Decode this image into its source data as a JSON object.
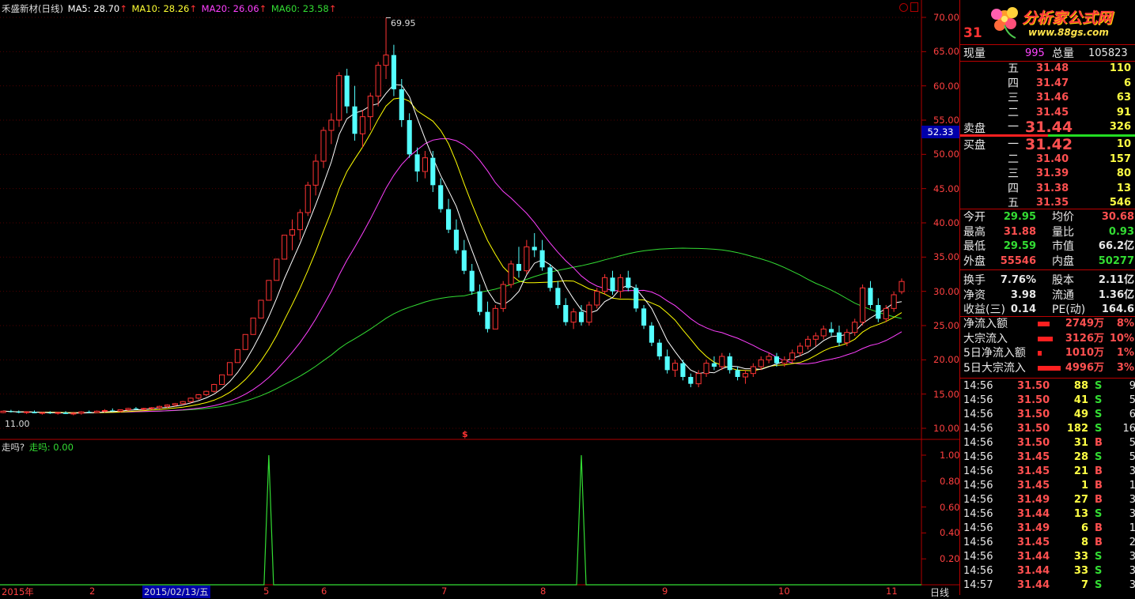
{
  "header": {
    "stock_label": "禾盛新材(日线)",
    "ma5_label": "MA5: 28.70",
    "ma10_label": "MA10: 28.26",
    "ma20_label": "MA20: 26.06",
    "ma60_label": "MA60: 23.58",
    "arrow": "↑"
  },
  "colors": {
    "up": "#ff3333",
    "down": "#54ffff",
    "ma5": "#ffffff",
    "ma10": "#ffff00",
    "ma20": "#ff40ff",
    "ma60": "#33dd33",
    "frame": "#b00000"
  },
  "price_axis": {
    "ticks": [
      "70.00",
      "65.00",
      "60.00",
      "55.00",
      "50.00",
      "45.00",
      "40.00",
      "35.00",
      "30.00",
      "25.00",
      "20.00",
      "15.00",
      "10.00"
    ],
    "current_marker": "52.33",
    "high_label": "69.95",
    "low_label": "11.00"
  },
  "indicator": {
    "title": "走吗?",
    "value_label": "走吗: 0.00",
    "ticks": [
      "1.00",
      "0.80",
      "0.60",
      "0.40",
      "0.20"
    ]
  },
  "time_axis": {
    "labels": [
      "2015年",
      "2",
      "2015/02/13/五",
      "5",
      "6",
      "7",
      "8",
      "9",
      "10",
      "11"
    ],
    "period_label": "日线"
  },
  "marker_s": "$",
  "quote": {
    "code": "31",
    "logo_text": "分析家公式网",
    "logo_url": "www.88gs.com",
    "current_label": "现量",
    "current_value": "995",
    "total_label": "总量",
    "total_value": "105823",
    "sell_label": "卖盘",
    "buy_label": "买盘",
    "asks": [
      {
        "level": "五",
        "price": "31.48",
        "vol": "110"
      },
      {
        "level": "四",
        "price": "31.47",
        "vol": "6"
      },
      {
        "level": "三",
        "price": "31.46",
        "vol": "63"
      },
      {
        "level": "二",
        "price": "31.45",
        "vol": "91"
      },
      {
        "level": "一",
        "price": "31.44",
        "vol": "326"
      }
    ],
    "bids": [
      {
        "level": "一",
        "price": "31.42",
        "vol": "10"
      },
      {
        "level": "二",
        "price": "31.40",
        "vol": "157"
      },
      {
        "level": "三",
        "price": "31.39",
        "vol": "80"
      },
      {
        "level": "四",
        "price": "31.38",
        "vol": "13"
      },
      {
        "level": "五",
        "price": "31.35",
        "vol": "546"
      }
    ],
    "stats": [
      {
        "l1": "今开",
        "v1": "29.95",
        "c1": "grn",
        "l2": "均价",
        "v2": "30.68",
        "c2": "red"
      },
      {
        "l1": "最高",
        "v1": "31.88",
        "c1": "red",
        "l2": "量比",
        "v2": "0.93",
        "c2": "grn"
      },
      {
        "l1": "最低",
        "v1": "29.59",
        "c1": "grn",
        "l2": "市值",
        "v2": "66.2亿",
        "c2": "wht"
      },
      {
        "l1": "外盘",
        "v1": "55546",
        "c1": "red",
        "l2": "内盘",
        "v2": "50277",
        "c2": "grn"
      },
      {
        "l1": "换手",
        "v1": "7.76%",
        "c1": "wht",
        "l2": "股本",
        "v2": "2.11亿",
        "c2": "wht"
      },
      {
        "l1": "净资",
        "v1": "3.98",
        "c1": "wht",
        "l2": "流通",
        "v2": "1.36亿",
        "c2": "wht"
      },
      {
        "l1": "收益(三)",
        "v1": "0.14",
        "c1": "wht",
        "l2": "PE(动)",
        "v2": "164.6",
        "c2": "wht"
      }
    ],
    "flows": [
      {
        "label": "净流入额",
        "value": "2749万",
        "pct": "8%",
        "bar": 0.35
      },
      {
        "label": "大宗流入",
        "value": "3126万",
        "pct": "10%",
        "bar": 0.45
      },
      {
        "label": "5日净流入额",
        "value": "1010万",
        "pct": "1%",
        "bar": 0.12
      },
      {
        "label": "5日大宗流入",
        "value": "4996万",
        "pct": "3%",
        "bar": 0.7
      }
    ],
    "ticks": [
      {
        "time": "14:56",
        "price": "31.50",
        "vol": "88",
        "side": "S",
        "extra": "9"
      },
      {
        "time": "14:56",
        "price": "31.50",
        "vol": "41",
        "side": "S",
        "extra": "5"
      },
      {
        "time": "14:56",
        "price": "31.50",
        "vol": "49",
        "side": "S",
        "extra": "6"
      },
      {
        "time": "14:56",
        "price": "31.50",
        "vol": "182",
        "side": "S",
        "extra": "16"
      },
      {
        "time": "14:56",
        "price": "31.50",
        "vol": "31",
        "side": "B",
        "extra": "5"
      },
      {
        "time": "14:56",
        "price": "31.45",
        "vol": "28",
        "side": "S",
        "extra": "5"
      },
      {
        "time": "14:56",
        "price": "31.45",
        "vol": "21",
        "side": "B",
        "extra": "3"
      },
      {
        "time": "14:56",
        "price": "31.45",
        "vol": "1",
        "side": "B",
        "extra": "1"
      },
      {
        "time": "14:56",
        "price": "31.49",
        "vol": "27",
        "side": "B",
        "extra": "3"
      },
      {
        "time": "14:56",
        "price": "31.44",
        "vol": "13",
        "side": "S",
        "extra": "3"
      },
      {
        "time": "14:56",
        "price": "31.49",
        "vol": "6",
        "side": "B",
        "extra": "1"
      },
      {
        "time": "14:56",
        "price": "31.45",
        "vol": "8",
        "side": "B",
        "extra": "2"
      },
      {
        "time": "14:56",
        "price": "31.44",
        "vol": "33",
        "side": "S",
        "extra": "3"
      },
      {
        "time": "14:56",
        "price": "31.44",
        "vol": "33",
        "side": "S",
        "extra": "3"
      },
      {
        "time": "14:57",
        "price": "31.44",
        "vol": "7",
        "side": "S",
        "extra": "3"
      }
    ]
  },
  "chart_data": {
    "type": "candlestick",
    "title": "禾盛新材(日线)",
    "ylim": [
      10,
      70
    ],
    "candles": [
      [
        12.3,
        12.6,
        12.2,
        12.5
      ],
      [
        12.5,
        12.7,
        12.3,
        12.4
      ],
      [
        12.4,
        12.6,
        12.2,
        12.3
      ],
      [
        12.3,
        12.5,
        12.1,
        12.4
      ],
      [
        12.4,
        12.6,
        12.2,
        12.2
      ],
      [
        12.2,
        12.4,
        12.0,
        12.3
      ],
      [
        12.3,
        12.5,
        12.1,
        12.2
      ],
      [
        12.2,
        12.4,
        12.0,
        12.3
      ],
      [
        12.3,
        12.5,
        12.1,
        12.1
      ],
      [
        12.1,
        12.4,
        11.9,
        12.2
      ],
      [
        12.2,
        12.5,
        12.0,
        12.4
      ],
      [
        12.4,
        12.6,
        12.2,
        12.3
      ],
      [
        12.3,
        12.6,
        12.2,
        12.5
      ],
      [
        12.5,
        12.8,
        12.3,
        12.6
      ],
      [
        12.6,
        12.9,
        12.4,
        12.5
      ],
      [
        12.5,
        12.7,
        12.3,
        12.7
      ],
      [
        12.7,
        13.0,
        12.5,
        12.9
      ],
      [
        12.9,
        13.1,
        12.7,
        12.8
      ],
      [
        12.8,
        13.0,
        12.6,
        12.9
      ],
      [
        12.9,
        13.1,
        12.7,
        13.0
      ],
      [
        13.0,
        13.3,
        12.8,
        13.2
      ],
      [
        13.2,
        13.5,
        13.0,
        13.4
      ],
      [
        13.4,
        13.7,
        13.2,
        13.6
      ],
      [
        13.6,
        14.0,
        13.4,
        13.9
      ],
      [
        13.9,
        14.5,
        13.7,
        14.4
      ],
      [
        14.4,
        15.0,
        14.2,
        14.9
      ],
      [
        14.9,
        15.5,
        14.7,
        15.4
      ],
      [
        15.4,
        16.5,
        15.2,
        16.4
      ],
      [
        16.4,
        17.8,
        16.4,
        17.8
      ],
      [
        17.8,
        19.6,
        17.8,
        19.6
      ],
      [
        19.6,
        21.5,
        19.6,
        21.5
      ],
      [
        21.5,
        23.7,
        21.5,
        23.7
      ],
      [
        23.7,
        26.1,
        23.7,
        26.1
      ],
      [
        26.1,
        28.7,
        26.1,
        28.7
      ],
      [
        28.7,
        31.6,
        28.7,
        31.6
      ],
      [
        31.6,
        34.7,
        31.6,
        34.7
      ],
      [
        34.7,
        38.2,
        34.7,
        38.2
      ],
      [
        38.2,
        40.5,
        36.0,
        39.0
      ],
      [
        39.0,
        42.0,
        37.5,
        41.5
      ],
      [
        41.5,
        46.0,
        41.0,
        45.5
      ],
      [
        45.5,
        50.0,
        44.0,
        49.0
      ],
      [
        49.0,
        54.0,
        48.0,
        53.5
      ],
      [
        53.5,
        56.0,
        51.5,
        55.0
      ],
      [
        55.0,
        62.0,
        54.0,
        61.5
      ],
      [
        61.5,
        62.5,
        56.0,
        57.0
      ],
      [
        57.0,
        60.0,
        52.0,
        53.0
      ],
      [
        53.0,
        56.5,
        51.0,
        55.5
      ],
      [
        55.5,
        59.0,
        53.5,
        58.5
      ],
      [
        58.5,
        63.5,
        57.0,
        63.0
      ],
      [
        63.0,
        69.95,
        61.0,
        64.5
      ],
      [
        64.5,
        66.0,
        58.5,
        59.5
      ],
      [
        59.5,
        61.0,
        54.0,
        55.0
      ],
      [
        55.0,
        56.0,
        49.5,
        50.0
      ],
      [
        50.0,
        51.0,
        46.0,
        47.5
      ],
      [
        47.5,
        50.5,
        46.5,
        49.5
      ],
      [
        49.5,
        50.5,
        44.5,
        45.5
      ],
      [
        45.5,
        46.5,
        41.5,
        42.0
      ],
      [
        42.0,
        43.5,
        38.5,
        39.0
      ],
      [
        39.0,
        40.5,
        35.5,
        36.0
      ],
      [
        36.0,
        37.5,
        32.5,
        33.0
      ],
      [
        33.0,
        34.0,
        29.5,
        30.0
      ],
      [
        30.0,
        31.0,
        26.5,
        27.0
      ],
      [
        27.0,
        28.5,
        24.0,
        24.5
      ],
      [
        24.5,
        28.0,
        24.5,
        27.5
      ],
      [
        27.5,
        31.5,
        27.0,
        31.0
      ],
      [
        31.0,
        34.5,
        30.5,
        34.0
      ],
      [
        34.0,
        36.5,
        32.0,
        33.0
      ],
      [
        33.0,
        37.5,
        32.5,
        36.5
      ],
      [
        36.5,
        38.5,
        35.0,
        36.0
      ],
      [
        36.0,
        37.5,
        33.0,
        33.5
      ],
      [
        33.5,
        34.0,
        30.0,
        30.5
      ],
      [
        30.5,
        31.5,
        27.5,
        28.0
      ],
      [
        28.0,
        29.0,
        25.0,
        25.5
      ],
      [
        25.5,
        27.5,
        24.5,
        27.0
      ],
      [
        27.0,
        28.0,
        25.0,
        25.5
      ],
      [
        25.5,
        28.5,
        25.0,
        28.0
      ],
      [
        28.0,
        30.5,
        27.5,
        30.0
      ],
      [
        30.0,
        32.5,
        29.5,
        32.0
      ],
      [
        32.0,
        33.0,
        29.5,
        30.0
      ],
      [
        30.0,
        32.5,
        29.0,
        32.0
      ],
      [
        32.0,
        33.0,
        30.0,
        30.5
      ],
      [
        30.5,
        31.0,
        27.0,
        27.5
      ],
      [
        27.5,
        28.0,
        24.5,
        25.0
      ],
      [
        25.0,
        25.5,
        22.0,
        22.5
      ],
      [
        22.5,
        23.0,
        20.0,
        20.5
      ],
      [
        20.5,
        21.5,
        18.0,
        18.5
      ],
      [
        18.5,
        20.0,
        17.5,
        19.5
      ],
      [
        19.5,
        20.0,
        17.0,
        17.5
      ],
      [
        17.5,
        18.0,
        16.0,
        16.5
      ],
      [
        16.5,
        18.5,
        16.0,
        18.0
      ],
      [
        18.0,
        20.0,
        17.5,
        19.5
      ],
      [
        19.5,
        20.5,
        18.5,
        19.0
      ],
      [
        19.0,
        21.0,
        18.5,
        20.5
      ],
      [
        20.5,
        21.0,
        18.0,
        18.5
      ],
      [
        18.5,
        19.0,
        17.0,
        17.5
      ],
      [
        17.5,
        18.5,
        16.5,
        18.0
      ],
      [
        18.0,
        19.5,
        17.5,
        19.0
      ],
      [
        19.0,
        20.5,
        18.5,
        20.0
      ],
      [
        20.0,
        21.0,
        19.5,
        20.5
      ],
      [
        20.5,
        21.0,
        19.0,
        19.5
      ],
      [
        19.5,
        20.5,
        19.0,
        20.0
      ],
      [
        20.0,
        21.5,
        19.5,
        21.0
      ],
      [
        21.0,
        22.5,
        20.5,
        22.0
      ],
      [
        22.0,
        23.5,
        21.5,
        23.0
      ],
      [
        23.0,
        24.0,
        22.0,
        23.5
      ],
      [
        23.5,
        25.0,
        23.0,
        24.5
      ],
      [
        24.5,
        25.5,
        23.5,
        24.0
      ],
      [
        24.0,
        25.0,
        22.0,
        22.5
      ],
      [
        22.5,
        24.5,
        22.0,
        24.0
      ],
      [
        24.0,
        26.0,
        23.5,
        25.5
      ],
      [
        25.5,
        31.0,
        25.0,
        30.5
      ],
      [
        30.5,
        31.5,
        27.5,
        28.0
      ],
      [
        28.0,
        29.0,
        25.5,
        26.0
      ],
      [
        26.0,
        28.0,
        25.5,
        27.5
      ],
      [
        27.5,
        30.0,
        27.0,
        29.5
      ],
      [
        29.95,
        31.88,
        29.59,
        31.44
      ]
    ],
    "indicator_spikes": [
      "2015-06",
      "2015-09"
    ]
  }
}
